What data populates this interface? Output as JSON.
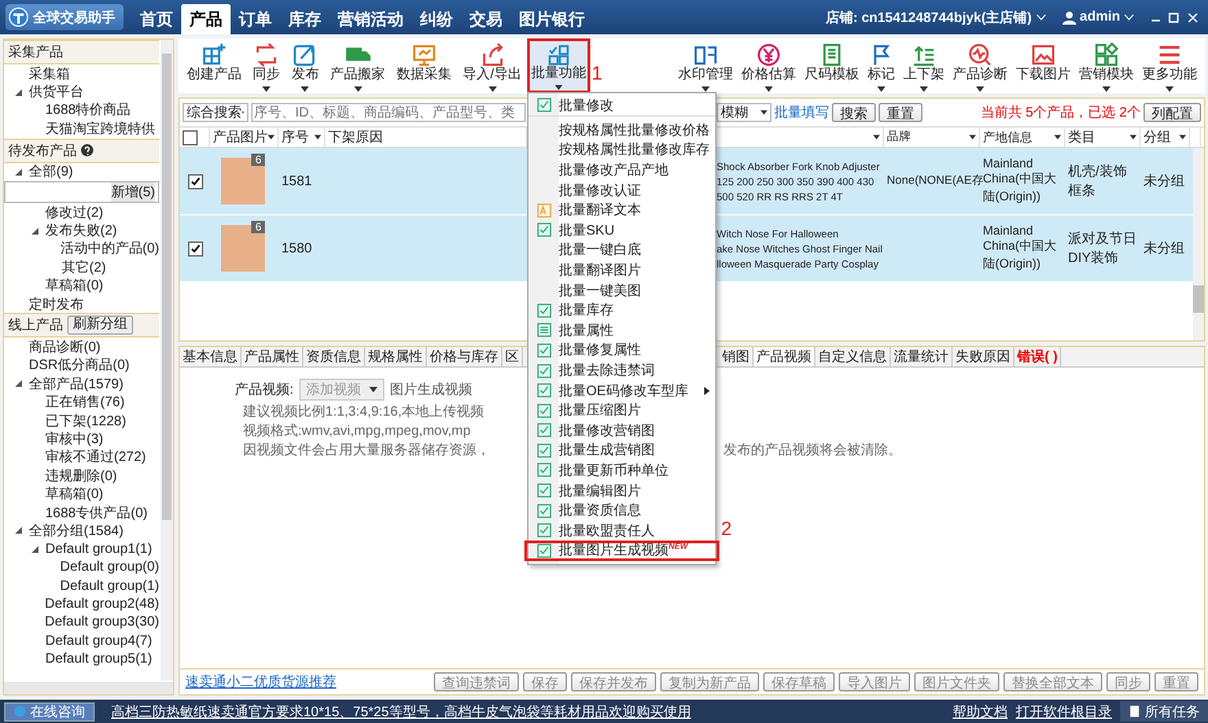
{
  "app": {
    "name": "全球交易助手"
  },
  "nav": [
    {
      "label": "首页",
      "selected": false
    },
    {
      "label": "产品",
      "selected": true
    },
    {
      "label": "订单",
      "selected": false
    },
    {
      "label": "库存",
      "selected": false
    },
    {
      "label": "营销活动",
      "selected": false
    },
    {
      "label": "纠纷",
      "selected": false
    },
    {
      "label": "交易",
      "selected": false
    },
    {
      "label": "图片银行",
      "selected": false
    }
  ],
  "shop": "店铺: cn1541248744bjyk(主店铺)",
  "user": "admin",
  "sidebar": {
    "sections": [
      {
        "title": "采集产品",
        "help": false,
        "items": [
          {
            "label": "采集箱",
            "selected": false
          },
          {
            "label": "供货平台",
            "selected": false,
            "expanded": true,
            "children": [
              {
                "label": "1688特价商品",
                "selected": false
              },
              {
                "label": "天猫淘宝跨境特供",
                "selected": false
              }
            ]
          }
        ]
      },
      {
        "title": "待发布产品",
        "help": true,
        "items": [
          {
            "label": "全部(9)",
            "selected": false,
            "expanded": true,
            "children": [
              {
                "label": "新增(5)",
                "selected": true
              },
              {
                "label": "修改过(2)",
                "selected": false
              },
              {
                "label": "发布失败(2)",
                "selected": false,
                "expanded": true,
                "children": [
                  {
                    "label": "活动中的产品(0)",
                    "selected": false
                  },
                  {
                    "label": "其它(2)",
                    "selected": false
                  }
                ]
              },
              {
                "label": "草稿箱(0)",
                "selected": false
              }
            ]
          },
          {
            "label": "定时发布",
            "selected": false
          }
        ]
      },
      {
        "title": "线上产品",
        "button": "刷新分组",
        "help": false,
        "items": [
          {
            "label": "商品诊断(0)",
            "selected": false
          },
          {
            "label": "DSR低分商品(0)",
            "selected": false
          },
          {
            "label": "全部产品(1579)",
            "selected": false,
            "expanded": true,
            "children": [
              {
                "label": "正在销售(76)",
                "selected": false
              },
              {
                "label": "已下架(1228)",
                "selected": false
              },
              {
                "label": "审核中(3)",
                "selected": false
              },
              {
                "label": "审核不通过(272)",
                "selected": false
              },
              {
                "label": "违规删除(0)",
                "selected": false
              },
              {
                "label": "草稿箱(0)",
                "selected": false
              },
              {
                "label": "1688专供产品(0)",
                "selected": false
              }
            ]
          },
          {
            "label": "全部分组(1584)",
            "selected": false,
            "expanded": true,
            "children": [
              {
                "label": "Default group1(1)",
                "selected": false,
                "expanded": true,
                "children": [
                  {
                    "label": "Default group(0)",
                    "selected": false
                  },
                  {
                    "label": "Default group(1)",
                    "selected": false
                  }
                ]
              },
              {
                "label": "Default group2(48)",
                "selected": false
              },
              {
                "label": "Default group3(30)",
                "selected": false
              },
              {
                "label": "Default group4(7)",
                "selected": false
              },
              {
                "label": "Default group5(1)",
                "selected": false
              }
            ]
          }
        ]
      }
    ]
  },
  "toolbar_left": [
    {
      "kind": "create",
      "label": "创建产品",
      "dropdown": false
    },
    {
      "kind": "sync",
      "label": "同步",
      "dropdown": true
    },
    {
      "kind": "publish",
      "label": "发布",
      "dropdown": true
    },
    {
      "kind": "truck",
      "label": "产品搬家",
      "dropdown": true
    },
    {
      "kind": "collect",
      "label": "数据采集",
      "dropdown": false
    },
    {
      "kind": "export",
      "label": "导入/导出",
      "dropdown": true
    },
    {
      "kind": "grid",
      "label": "批量功能",
      "dropdown": true,
      "highlighted": true,
      "callout": "1"
    }
  ],
  "toolbar_right": [
    {
      "kind": "watermark",
      "label": "水印管理",
      "dropdown": true
    },
    {
      "kind": "price",
      "label": "价格估算",
      "dropdown": true
    },
    {
      "kind": "size",
      "label": "尺码模板",
      "dropdown": false
    },
    {
      "kind": "flag",
      "label": "标记",
      "dropdown": true
    },
    {
      "kind": "updown",
      "label": "上下架",
      "dropdown": true
    },
    {
      "kind": "diagnose",
      "label": "产品诊断",
      "dropdown": true
    },
    {
      "kind": "image",
      "label": "下载图片",
      "dropdown": false
    },
    {
      "kind": "modules",
      "label": "营销模块",
      "dropdown": true
    },
    {
      "kind": "menu",
      "label": "更多功能",
      "dropdown": true
    }
  ],
  "search": {
    "mode": "综合搜索",
    "placeholder": "序号、ID、标题、商品编码、产品型号、类",
    "match": "模糊",
    "fill_link": "批量填写",
    "search_button": "搜索",
    "reset_button": "重置",
    "summary": "当前共 5个产品，已选 2个",
    "columns_button": "列配置"
  },
  "table": {
    "all_checked": false,
    "columns": [
      "产品图片",
      "序号",
      "下架原因",
      "",
      "品牌",
      "产地信息",
      "类目",
      "分组"
    ],
    "rows": [
      {
        "checked": true,
        "image_count": "6",
        "seq": "1581",
        "title_lines": [
          "Shock Absorber Fork Knob Adjuster",
          "125 200 250 300 350 390 400 430",
          "500 520 RR RS RRS 2T 4T"
        ],
        "brand": "None(NONE(AE存",
        "origin": "Mainland China(中国大陆(Origin))",
        "category": "机壳/装饰框条",
        "group": "未分组"
      },
      {
        "checked": true,
        "image_count": "6",
        "seq": "1580",
        "title_lines": [
          "Witch Nose For Halloween",
          "ake Nose Witches Ghost Finger Nail",
          "lloween Masquerade Party Cosplay"
        ],
        "brand": "",
        "origin": "Mainland China(中国大陆(Origin))",
        "category": "派对及节日DIY装饰",
        "group": "未分组"
      }
    ]
  },
  "detail_tabs": [
    {
      "label": "基本信息",
      "selected": false,
      "alert": false
    },
    {
      "label": "产品属性",
      "selected": false,
      "alert": false
    },
    {
      "label": "资质信息",
      "selected": false,
      "alert": false
    },
    {
      "label": "规格属性",
      "selected": false,
      "alert": false
    },
    {
      "label": "价格与库存",
      "selected": false,
      "alert": false
    },
    {
      "label": "区",
      "selected": false,
      "alert": false
    },
    {
      "label": "销图",
      "selected": false,
      "alert": false
    },
    {
      "label": "产品视频",
      "selected": true,
      "alert": false
    },
    {
      "label": "自定义信息",
      "selected": false,
      "alert": false
    },
    {
      "label": "流量统计",
      "selected": false,
      "alert": false
    },
    {
      "label": "失败原因",
      "selected": false,
      "alert": false
    },
    {
      "label": "错误( )",
      "selected": false,
      "alert": true
    }
  ],
  "video": {
    "label": "产品视频:",
    "add_button": "添加视频",
    "add_disabled": true,
    "generate": "图片生成视频",
    "notes": [
      "建议视频比例1:1,3:4,9:16,本地上传视频",
      "视频格式:wmv,avi,mpg,mpeg,mov,mp",
      "因视频文件会占用大量服务器储存资源，"
    ],
    "note_tail": "发布的产品视频将会被清除。"
  },
  "detail_link": "速卖通小二优质货源推荐",
  "detail_buttons": [
    "查询违禁词",
    "保存",
    "保存并发布",
    "复制为新产品",
    "保存草稿",
    "导入图片",
    "图片文件夹",
    "替换全部文本",
    "同步",
    "重置"
  ],
  "menu": [
    {
      "kind": "edit",
      "label": "批量修改"
    },
    {
      "kind": "plain",
      "label": "按规格属性批量修改价格"
    },
    {
      "kind": "plain",
      "label": "按规格属性批量修改库存"
    },
    {
      "kind": "plain",
      "label": "批量修改产品产地"
    },
    {
      "kind": "plain",
      "label": "批量修改认证"
    },
    {
      "kind": "translate",
      "label": "批量翻译文本"
    },
    {
      "kind": "edit",
      "label": "批量SKU"
    },
    {
      "kind": "plain",
      "label": "批量一键白底"
    },
    {
      "kind": "plain",
      "label": "批量翻译图片"
    },
    {
      "kind": "plain",
      "label": "批量一键美图"
    },
    {
      "kind": "edit",
      "label": "批量库存"
    },
    {
      "kind": "attr",
      "label": "批量属性"
    },
    {
      "kind": "edit",
      "label": "批量修复属性"
    },
    {
      "kind": "edit",
      "label": "批量去除违禁词"
    },
    {
      "kind": "edit",
      "label": "批量OE码修改车型库",
      "submenu": true
    },
    {
      "kind": "edit",
      "label": "批量压缩图片"
    },
    {
      "kind": "edit",
      "label": "批量修改营销图"
    },
    {
      "kind": "edit",
      "label": "批量生成营销图"
    },
    {
      "kind": "edit",
      "label": "批量更新币种单位"
    },
    {
      "kind": "edit",
      "label": "批量编辑图片"
    },
    {
      "kind": "edit",
      "label": "批量资质信息"
    },
    {
      "kind": "edit",
      "label": "批量欧盟责任人"
    },
    {
      "kind": "edit",
      "label": "批量图片生成视频",
      "badge": "NEW",
      "highlighted": true,
      "callout": "2"
    }
  ],
  "status_bar": {
    "consult": "在线咨询",
    "ticker": "高档三防热敏纸速卖通官方要求10*15、75*25等型号，高档牛皮气泡袋等耗材用品欢迎购买使用",
    "links": [
      "帮助文档",
      "打开软件根目录"
    ],
    "tasks": "所有任务"
  }
}
